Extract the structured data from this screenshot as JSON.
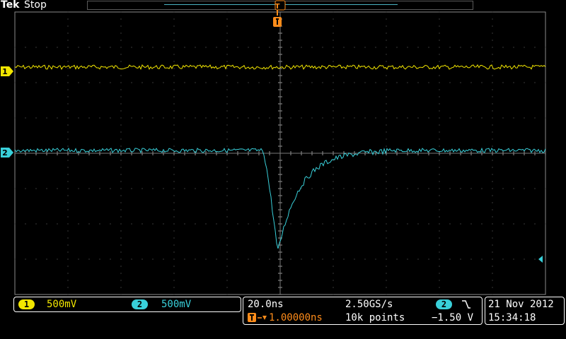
{
  "header": {
    "brand": "Tek",
    "run_status": "Stop"
  },
  "markers": {
    "trigger_label": "T",
    "ch1_label": "1",
    "ch2_label": "2"
  },
  "channels": [
    {
      "number": "1",
      "scale": "500mV",
      "color": "#f2e600"
    },
    {
      "number": "2",
      "scale": "500mV",
      "color": "#39d0da"
    }
  ],
  "acquisition": {
    "timebase": "20.0ns",
    "sample_rate": "2.50GS/s",
    "record_length": "10k points",
    "trigger_delay": "1.00000ns",
    "trigger_source": "2",
    "trigger_slope_icon": "falling-edge-icon",
    "trigger_level": "−1.50 V"
  },
  "datetime": {
    "date": "21 Nov 2012",
    "time": "15:34:18"
  },
  "colors": {
    "ch1": "#f2e600",
    "ch2": "#39d0da",
    "trigger": "#ff8c1a",
    "grid": "#6e6e6e"
  }
}
